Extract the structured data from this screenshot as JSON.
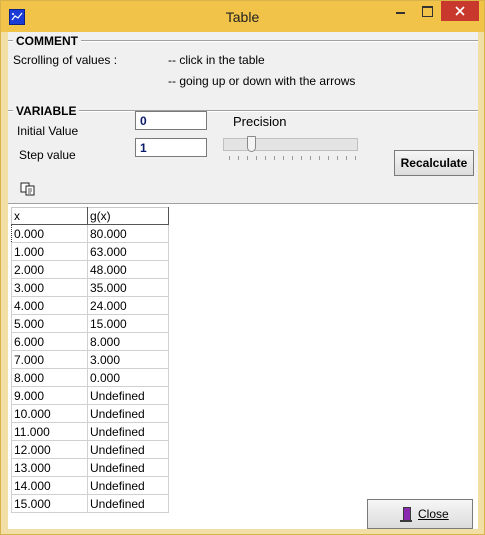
{
  "window": {
    "title": "Table"
  },
  "comment": {
    "heading": "COMMENT",
    "label": "Scrolling of values :",
    "line1": "-- click in the table",
    "line2": "-- going up or down with the arrows"
  },
  "variable": {
    "heading": "VARIABLE",
    "initial_label": "Initial Value",
    "initial_value": "0",
    "step_label": "Step value",
    "step_value": "1",
    "precision_label": "Precision",
    "recalculate_label": "Recalculate"
  },
  "table": {
    "columns": [
      "x",
      "g(x)"
    ],
    "rows": [
      [
        "0.000",
        "80.000"
      ],
      [
        "1.000",
        "63.000"
      ],
      [
        "2.000",
        "48.000"
      ],
      [
        "3.000",
        "35.000"
      ],
      [
        "4.000",
        "24.000"
      ],
      [
        "5.000",
        "15.000"
      ],
      [
        "6.000",
        "8.000"
      ],
      [
        "7.000",
        "3.000"
      ],
      [
        "8.000",
        "0.000"
      ],
      [
        "9.000",
        "Undefined"
      ],
      [
        "10.000",
        "Undefined"
      ],
      [
        "11.000",
        "Undefined"
      ],
      [
        "12.000",
        "Undefined"
      ],
      [
        "13.000",
        "Undefined"
      ],
      [
        "14.000",
        "Undefined"
      ],
      [
        "15.000",
        "Undefined"
      ]
    ]
  },
  "footer": {
    "close_label": "Close"
  },
  "colors": {
    "titlebar": "#f2c349",
    "close_button": "#c8382c",
    "client": "#f0f0f0"
  }
}
